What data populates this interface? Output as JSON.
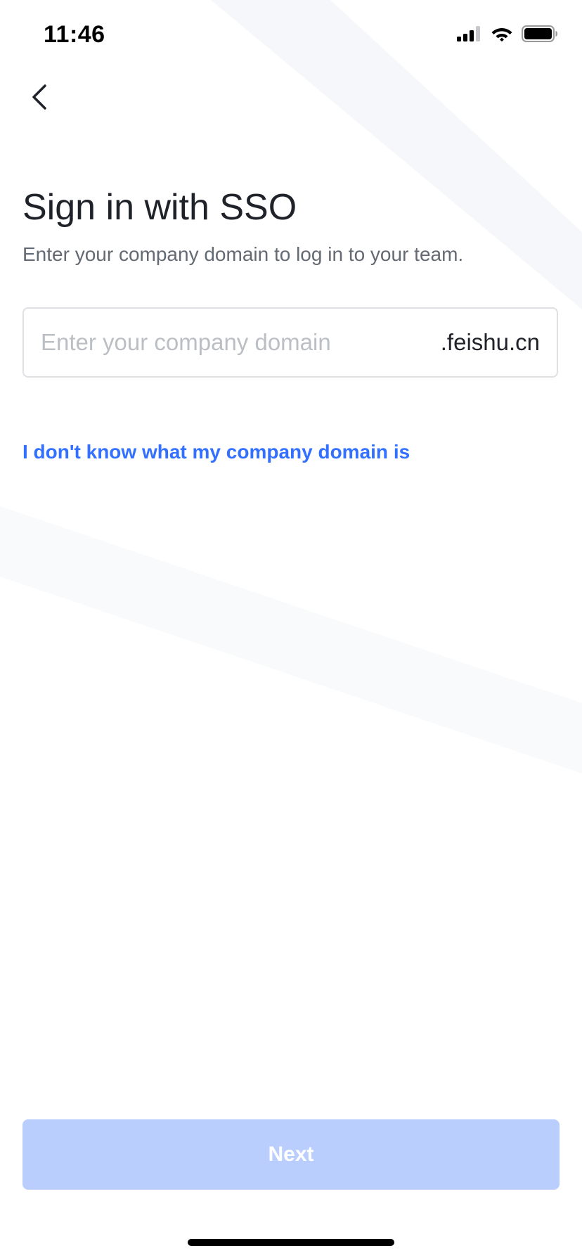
{
  "status_bar": {
    "time": "11:46",
    "icons": [
      "cellular-signal-icon",
      "wifi-icon",
      "battery-icon"
    ]
  },
  "nav": {
    "back_icon": "chevron-left-icon"
  },
  "header": {
    "title": "Sign in with SSO",
    "subtitle": "Enter your company domain to log in to your team."
  },
  "form": {
    "domain_input": {
      "value": "",
      "placeholder": "Enter your company domain"
    },
    "domain_suffix": ".feishu.cn"
  },
  "help_link": "I don't know what my company domain is",
  "actions": {
    "next_label": "Next",
    "next_enabled": false
  },
  "colors": {
    "accent": "#3370ff",
    "button_disabled_bg": "#bacefd",
    "title_text": "#1f2329",
    "secondary_text": "#646a73",
    "placeholder_text": "#bbbfc4",
    "border": "#dee0e3"
  }
}
